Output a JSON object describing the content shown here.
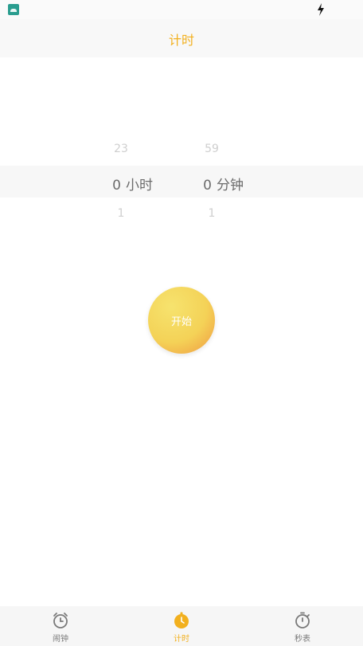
{
  "status_bar": {
    "app_icon": "android-app-icon",
    "charging_icon": "charging-bolt-icon"
  },
  "header": {
    "title": "计时"
  },
  "picker": {
    "hours": {
      "prev": "23",
      "selected_value": "0",
      "unit": "小时",
      "next": "1"
    },
    "minutes": {
      "prev": "59",
      "selected_value": "0",
      "unit": "分钟",
      "next": "1"
    }
  },
  "start_button": {
    "label": "开始"
  },
  "bottom_nav": {
    "items": [
      {
        "label": "闹钟",
        "icon": "alarm-clock-icon"
      },
      {
        "label": "计时",
        "icon": "timer-icon",
        "active": true
      },
      {
        "label": "秒表",
        "icon": "stopwatch-icon"
      }
    ]
  },
  "colors": {
    "accent": "#f2b01e",
    "button_gradient_start": "#f6e36e",
    "button_gradient_end": "#f0a84f",
    "text_muted": "#cfcfcf",
    "text_primary": "#6b6b6b",
    "nav_inactive": "#7a7a7a"
  }
}
